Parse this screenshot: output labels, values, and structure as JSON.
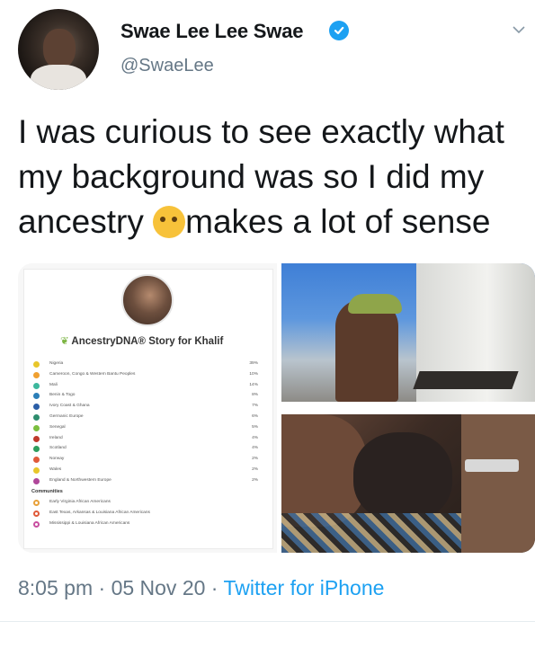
{
  "author": {
    "display_name": "Swae Lee Lee Swae",
    "handle": "@SwaeLee",
    "verified": true
  },
  "tweet": {
    "text_before_emoji": "I was curious to see exactly what my background was so I did my ancestry",
    "emoji_name": "thinking-face",
    "text_after_emoji": "makes a lot of sense"
  },
  "ancestry_card": {
    "brand": "AncestryDNA®",
    "title_suffix": " Story for Khalif",
    "regions": [
      {
        "label": "Nigeria",
        "percent": "39%",
        "color": "#e8c62a"
      },
      {
        "label": "Cameroon, Congo & Western Bantu Peoples",
        "percent": "10%",
        "color": "#f0a030"
      },
      {
        "label": "Mali",
        "percent": "14%",
        "color": "#3db89d"
      },
      {
        "label": "Benin & Togo",
        "percent": "8%",
        "color": "#2b7fb8"
      },
      {
        "label": "Ivory Coast & Ghana",
        "percent": "7%",
        "color": "#2b5ea7"
      },
      {
        "label": "Germanic Europe",
        "percent": "6%",
        "color": "#2e8d6e"
      },
      {
        "label": "Senegal",
        "percent": "5%",
        "color": "#7bbf3f"
      },
      {
        "label": "Ireland",
        "percent": "4%",
        "color": "#c0392b"
      },
      {
        "label": "Scotland",
        "percent": "4%",
        "color": "#2e9e5e"
      },
      {
        "label": "Norway",
        "percent": "2%",
        "color": "#e05a3a"
      },
      {
        "label": "Wales",
        "percent": "2%",
        "color": "#e8c62a"
      },
      {
        "label": "England & Northwestern Europe",
        "percent": "2%",
        "color": "#b0479a"
      }
    ],
    "communities_heading": "Communities",
    "communities": [
      {
        "label": "Early Virginia African Americans",
        "color": "#e8a13a"
      },
      {
        "label": "East Texas, Arkansas & Louisiana African Americans",
        "color": "#e05a3a"
      },
      {
        "label": "Mississippi & Louisiana African Americans",
        "color": "#c84fa0"
      }
    ]
  },
  "footer": {
    "time": "8:05 pm",
    "sep1": " · ",
    "date": "05 Nov 20",
    "sep2": " · ",
    "source": "Twitter for iPhone"
  },
  "colors": {
    "accent": "#1da1f2",
    "secondary_text": "#657786",
    "primary_text": "#14171a"
  }
}
